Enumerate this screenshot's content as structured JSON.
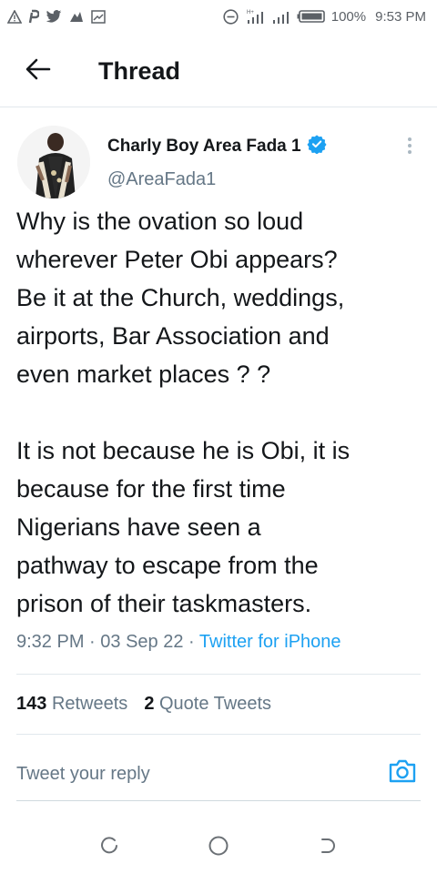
{
  "status_bar": {
    "battery": "100%",
    "time": "9:53 PM",
    "left_icons": [
      "warning-icon",
      "pinterest-icon",
      "twitter-icon",
      "ghost-icon",
      "image-icon"
    ],
    "right_icons": [
      "do-not-disturb-icon",
      "signal-icon",
      "signal-icon",
      "battery-icon"
    ]
  },
  "header": {
    "title": "Thread",
    "back_icon": "arrow-left-icon"
  },
  "tweet": {
    "author_name": "Charly Boy Area Fada 1",
    "handle": "@AreaFada1",
    "verified": true,
    "text_p1": "Why is the ovation so loud\nwherever Peter Obi appears?\nBe it at the Church, weddings,\nairports, Bar Association and\neven market places ? ?",
    "text_p2": "It is not because he is Obi, it is\nbecause for the first time\nNigerians have seen a\npathway to escape from the\nprison of their taskmasters.",
    "time": "9:32 PM",
    "date": "03 Sep 22",
    "source": "Twitter for iPhone",
    "separator": "·"
  },
  "stats": {
    "retweets_count": "143",
    "retweets_label": "Retweets",
    "quotes_count": "2",
    "quotes_label": "Quote Tweets"
  },
  "reply": {
    "placeholder": "Tweet your reply"
  },
  "colors": {
    "accent": "#1da1f2",
    "text": "#14171a",
    "muted": "#657786",
    "divider": "#e1e8ed"
  }
}
